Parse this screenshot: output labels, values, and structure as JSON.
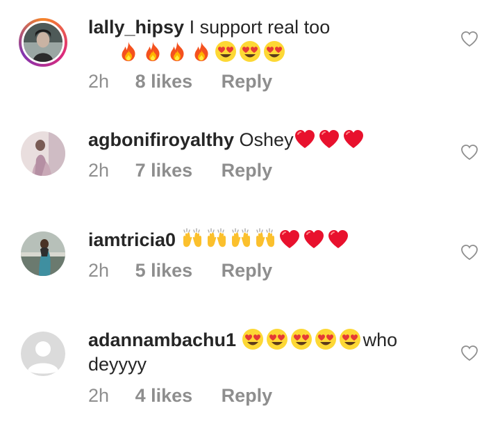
{
  "comments": [
    {
      "username": "lally_hipsy",
      "text": "I support real too",
      "text_continuation": "",
      "emojis": [
        "fire-emoji",
        "fire-emoji",
        "fire-emoji",
        "fire-emoji",
        "heart-eyes-emoji",
        "heart-eyes-emoji",
        "heart-eyes-emoji"
      ],
      "time": "2h",
      "likes": "8 likes",
      "reply_label": "Reply",
      "avatar_style": "photo-story-ring"
    },
    {
      "username": "agbonifiroyalthy",
      "text": "Oshey",
      "emojis": [
        "red-heart-emoji",
        "red-heart-emoji",
        "red-heart-emoji"
      ],
      "time": "2h",
      "likes": "7 likes",
      "reply_label": "Reply",
      "avatar_style": "photo"
    },
    {
      "username": "iamtricia0",
      "text": "",
      "emojis": [
        "raising-hands-emoji",
        "raising-hands-emoji",
        "raising-hands-emoji",
        "raising-hands-emoji",
        "red-heart-emoji",
        "red-heart-emoji",
        "red-heart-emoji"
      ],
      "time": "2h",
      "likes": "5 likes",
      "reply_label": "Reply",
      "avatar_style": "photo"
    },
    {
      "username": "adannambachu1",
      "text_after_emojis": "who deyyyy",
      "emojis": [
        "heart-eyes-emoji",
        "heart-eyes-emoji",
        "heart-eyes-emoji",
        "heart-eyes-emoji",
        "heart-eyes-emoji"
      ],
      "time": "2h",
      "likes": "4 likes",
      "reply_label": "Reply",
      "avatar_style": "default-placeholder"
    }
  ],
  "colors": {
    "username": "#262626",
    "meta": "#8e8e8e",
    "heart_outline": "#8e8e8e"
  }
}
